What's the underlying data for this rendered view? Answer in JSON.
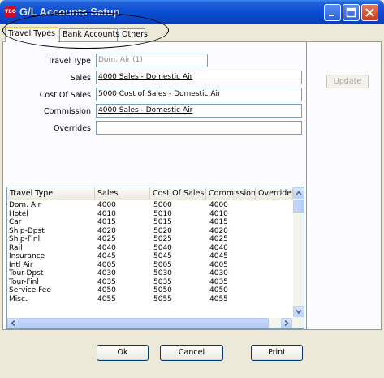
{
  "window": {
    "title": "G/L Accounts Setup",
    "app_icon_text": "TBO"
  },
  "tabs": [
    {
      "label": "Travel Types",
      "active": true
    },
    {
      "label": "Bank Accounts",
      "active": false
    },
    {
      "label": "Others",
      "active": false
    }
  ],
  "form": {
    "travel_type": {
      "label": "Travel Type",
      "value": "Dom. Air (1)"
    },
    "sales": {
      "label": "Sales",
      "value": "4000 Sales - Domestic Air"
    },
    "cost_of_sales": {
      "label": "Cost Of Sales",
      "value": "5000 Cost of Sales - Domestic Air"
    },
    "commission": {
      "label": "Commission",
      "value": "4000 Sales - Domestic Air"
    },
    "overrides": {
      "label": "Overrides",
      "value": ""
    }
  },
  "update_button": "Update",
  "table": {
    "columns": [
      "Travel Type",
      "Sales",
      "Cost Of Sales",
      "Commission",
      "Overrides"
    ],
    "rows": [
      [
        "Dom. Air",
        "4000",
        "5000",
        "4000"
      ],
      [
        "Hotel",
        "4010",
        "5010",
        "4010"
      ],
      [
        "Car",
        "4015",
        "5015",
        "4015"
      ],
      [
        "Ship-Dpst",
        "4020",
        "5020",
        "4020"
      ],
      [
        "Ship-Finl",
        "4025",
        "5025",
        "4025"
      ],
      [
        "Rail",
        "4040",
        "5040",
        "4040"
      ],
      [
        "Insurance",
        "4045",
        "5045",
        "4045"
      ],
      [
        "Intl Air",
        "4005",
        "5005",
        "4005"
      ],
      [
        "Tour-Dpst",
        "4030",
        "5030",
        "4030"
      ],
      [
        "Tour-Finl",
        "4035",
        "5035",
        "4035"
      ],
      [
        "Service Fee",
        "4050",
        "5050",
        "4050"
      ],
      [
        "Misc.",
        "4055",
        "5055",
        "4055"
      ]
    ]
  },
  "buttons": {
    "ok": "Ok",
    "cancel": "Cancel",
    "print": "Print"
  }
}
